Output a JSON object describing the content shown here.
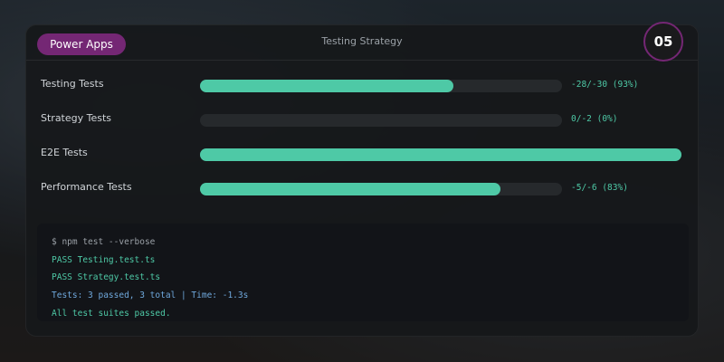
{
  "header": {
    "badge_label": "Power Apps",
    "title": "Testing Strategy",
    "step_number": "05"
  },
  "colors": {
    "accent": "#742774",
    "bar_fill": "#4ec9a6",
    "bar_track": "#26292c",
    "terminal_bg": "#121418"
  },
  "tests": [
    {
      "label": "Testing Tests",
      "value_text": "-28/-30 (93%)",
      "progress": 0.7
    },
    {
      "label": "Strategy Tests",
      "value_text": "0/-2 (0%)",
      "progress": 0.0
    },
    {
      "label": "E2E Tests",
      "value_text": "",
      "progress": 1.0,
      "full_width": true
    },
    {
      "label": "Performance Tests",
      "value_text": "-5/-6 (83%)",
      "progress": 0.83
    }
  ],
  "terminal": {
    "lines": [
      {
        "text": "$ npm test --verbose",
        "color": "#9aa0a6"
      },
      {
        "text": "PASS Testing.test.ts",
        "color": "#4ec9a6"
      },
      {
        "text": "PASS Strategy.test.ts",
        "color": "#4ec9a6"
      },
      {
        "text": "Tests: 3 passed, 3 total | Time: -1.3s",
        "color": "#6fa8dc"
      },
      {
        "text": "All test suites passed.",
        "color": "#4ec9a6"
      }
    ]
  }
}
